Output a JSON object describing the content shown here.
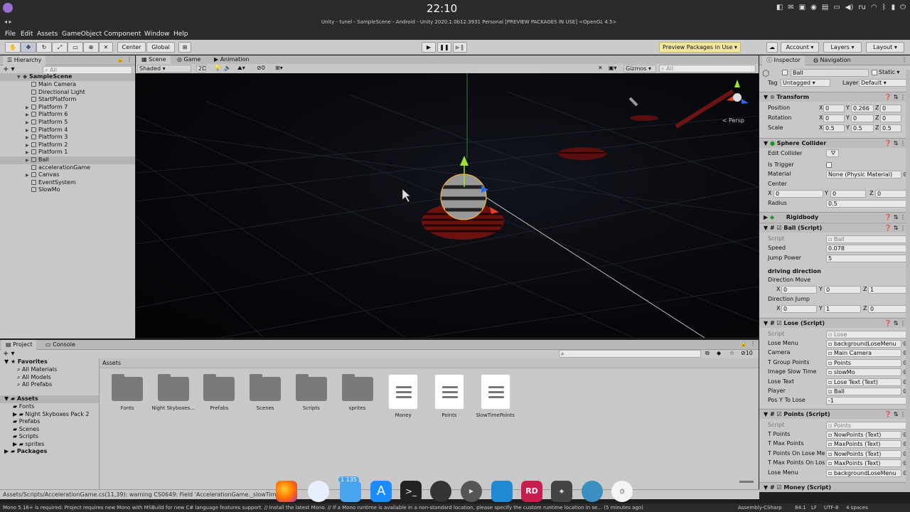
{
  "system": {
    "clock": "22:10",
    "lang": "ru"
  },
  "window": {
    "title": "Unity - tunel - SampleScene - Android - Unity 2020.1.0b12.3931 Personal [PREVIEW PACKAGES IN USE] <OpenGL 4.5>"
  },
  "menu": [
    "File",
    "Edit",
    "Assets",
    "GameObject",
    "Component",
    "Window",
    "Help"
  ],
  "toolbar": {
    "pivot": "Center",
    "space": "Global",
    "preview_packages": "Preview Packages in Use",
    "account": "Account",
    "layers": "Layers",
    "layout": "Layout"
  },
  "hierarchy": {
    "tab": "Hierarchy",
    "search_placeholder": "All",
    "scene": "SampleScene",
    "items": [
      {
        "label": "Main Camera",
        "expand": false
      },
      {
        "label": "Directional Light",
        "expand": false
      },
      {
        "label": "StartPlatform",
        "expand": false
      },
      {
        "label": "Platform 7",
        "expand": true
      },
      {
        "label": "Platform 6",
        "expand": true
      },
      {
        "label": "Platform 5",
        "expand": true
      },
      {
        "label": "Platform 4",
        "expand": true
      },
      {
        "label": "Platform 3",
        "expand": true
      },
      {
        "label": "Platform 2",
        "expand": true
      },
      {
        "label": "Platform 1",
        "expand": true
      },
      {
        "label": "Ball",
        "expand": true,
        "selected": true
      },
      {
        "label": "accelerationGame",
        "expand": false
      },
      {
        "label": "Canvas",
        "expand": true
      },
      {
        "label": "EventSystem",
        "expand": false
      },
      {
        "label": "SlowMo",
        "expand": false
      }
    ]
  },
  "scene_view": {
    "tabs": [
      "Scene",
      "Game",
      "Animation"
    ],
    "shading": "Shaded",
    "mode_2d": "2D",
    "hidden_count": "0",
    "gizmos": "Gizmos",
    "search_placeholder": "All",
    "persp": "< Persp"
  },
  "inspector": {
    "tabs": [
      "Inspector",
      "Navigation"
    ],
    "object_name": "Ball",
    "static_label": "Static",
    "tag_label": "Tag",
    "tag_value": "Untagged",
    "layer_label": "Layer",
    "layer_value": "Default",
    "transform": {
      "title": "Transform",
      "position_label": "Position",
      "rotation_label": "Rotation",
      "scale_label": "Scale",
      "position": [
        "0",
        "0.266",
        "0"
      ],
      "rotation": [
        "0",
        "0",
        "0"
      ],
      "scale": [
        "0.5",
        "0.5",
        "0.5"
      ]
    },
    "sphere_collider": {
      "title": "Sphere Collider",
      "edit_collider": "Edit Collider",
      "is_trigger": "Is Trigger",
      "material_label": "Material",
      "material_value": "None (Physic Material)",
      "center_label": "Center",
      "center": [
        "0",
        "0",
        "0"
      ],
      "radius_label": "Radius",
      "radius": "0.5"
    },
    "rigidbody": {
      "title": "Rigidbody"
    },
    "ball_script": {
      "title": "Ball (Script)",
      "script_label": "Script",
      "script_value": "Ball",
      "speed_label": "Speed",
      "speed": "0.078",
      "jump_power_label": "Jump Power",
      "jump_power": "5",
      "section": "driving direction",
      "direction_move_label": "Direction Move",
      "direction_move": [
        "0",
        "0",
        "1"
      ],
      "direction_jump_label": "Direction Jump",
      "direction_jump": [
        "0",
        "1",
        "0"
      ]
    },
    "lose_script": {
      "title": "Lose (Script)",
      "script_label": "Script",
      "script_value": "Lose",
      "rows": [
        {
          "label": "Lose Menu",
          "value": "backgroundLoseMenu"
        },
        {
          "label": "Camera",
          "value": "Main Camera"
        },
        {
          "label": "T Group Points",
          "value": "Points"
        },
        {
          "label": "Image Slow Time",
          "value": "slowMo"
        },
        {
          "label": "Lose Text",
          "value": "Lose Text (Text)"
        },
        {
          "label": "Player",
          "value": "Ball"
        }
      ],
      "pos_y_label": "Pos Y To Lose",
      "pos_y": "-1"
    },
    "points_script": {
      "title": "Points (Script)",
      "script_label": "Script",
      "script_value": "Points",
      "rows": [
        {
          "label": "T Points",
          "value": "NowPoints (Text)"
        },
        {
          "label": "T Max Points",
          "value": "MaxPoints (Text)"
        },
        {
          "label": "T Points On Lose Menu",
          "value": "NowPoints (Text)"
        },
        {
          "label": "T Max Points On Lose",
          "value": "MaxPoints (Text)"
        },
        {
          "label": "Lose Menu",
          "value": "backgroundLoseMenu"
        }
      ]
    },
    "money_script": {
      "title": "Money (Script)"
    }
  },
  "project": {
    "tabs": [
      "Project",
      "Console"
    ],
    "favorites_label": "Favorites",
    "favorites": [
      "All Materials",
      "All Models",
      "All Prefabs"
    ],
    "assets_label": "Assets",
    "asset_tree": [
      "Fonts",
      "Night Skyboxes Pack 2",
      "Prefabs",
      "Scenes",
      "Scripts",
      "sprites"
    ],
    "packages_label": "Packages",
    "breadcrumb": "Assets",
    "hidden_count": "10",
    "items": [
      {
        "label": "Fonts",
        "kind": "folder"
      },
      {
        "label": "Night Skyboxes...",
        "kind": "folder"
      },
      {
        "label": "Prefabs",
        "kind": "folder"
      },
      {
        "label": "Scenes",
        "kind": "folder"
      },
      {
        "label": "Scripts",
        "kind": "folder"
      },
      {
        "label": "sprites",
        "kind": "folder"
      },
      {
        "label": "Money",
        "kind": "script"
      },
      {
        "label": "Points",
        "kind": "script"
      },
      {
        "label": "SlowTimePoints",
        "kind": "script"
      }
    ]
  },
  "console_line": "Assets/Scripts/AccelerationGame.cs(11,39): warning CS0649: Field 'AccelerationGame._slowTime' is",
  "dock": {
    "badge": "1 135"
  },
  "status": {
    "message": "Mono 5.16+ is required: Project requires new Mono with MSBuild for new C# language features support. // Install the latest Mono. // If a Mono runtime is available in a non-standard location, please specify the custom runtime location in se... (5 minutes ago)",
    "project": "Assembly-CSharp",
    "position": "84:1",
    "line_ending": "LF",
    "encoding": "UTF-8",
    "indent": "4 spaces"
  }
}
